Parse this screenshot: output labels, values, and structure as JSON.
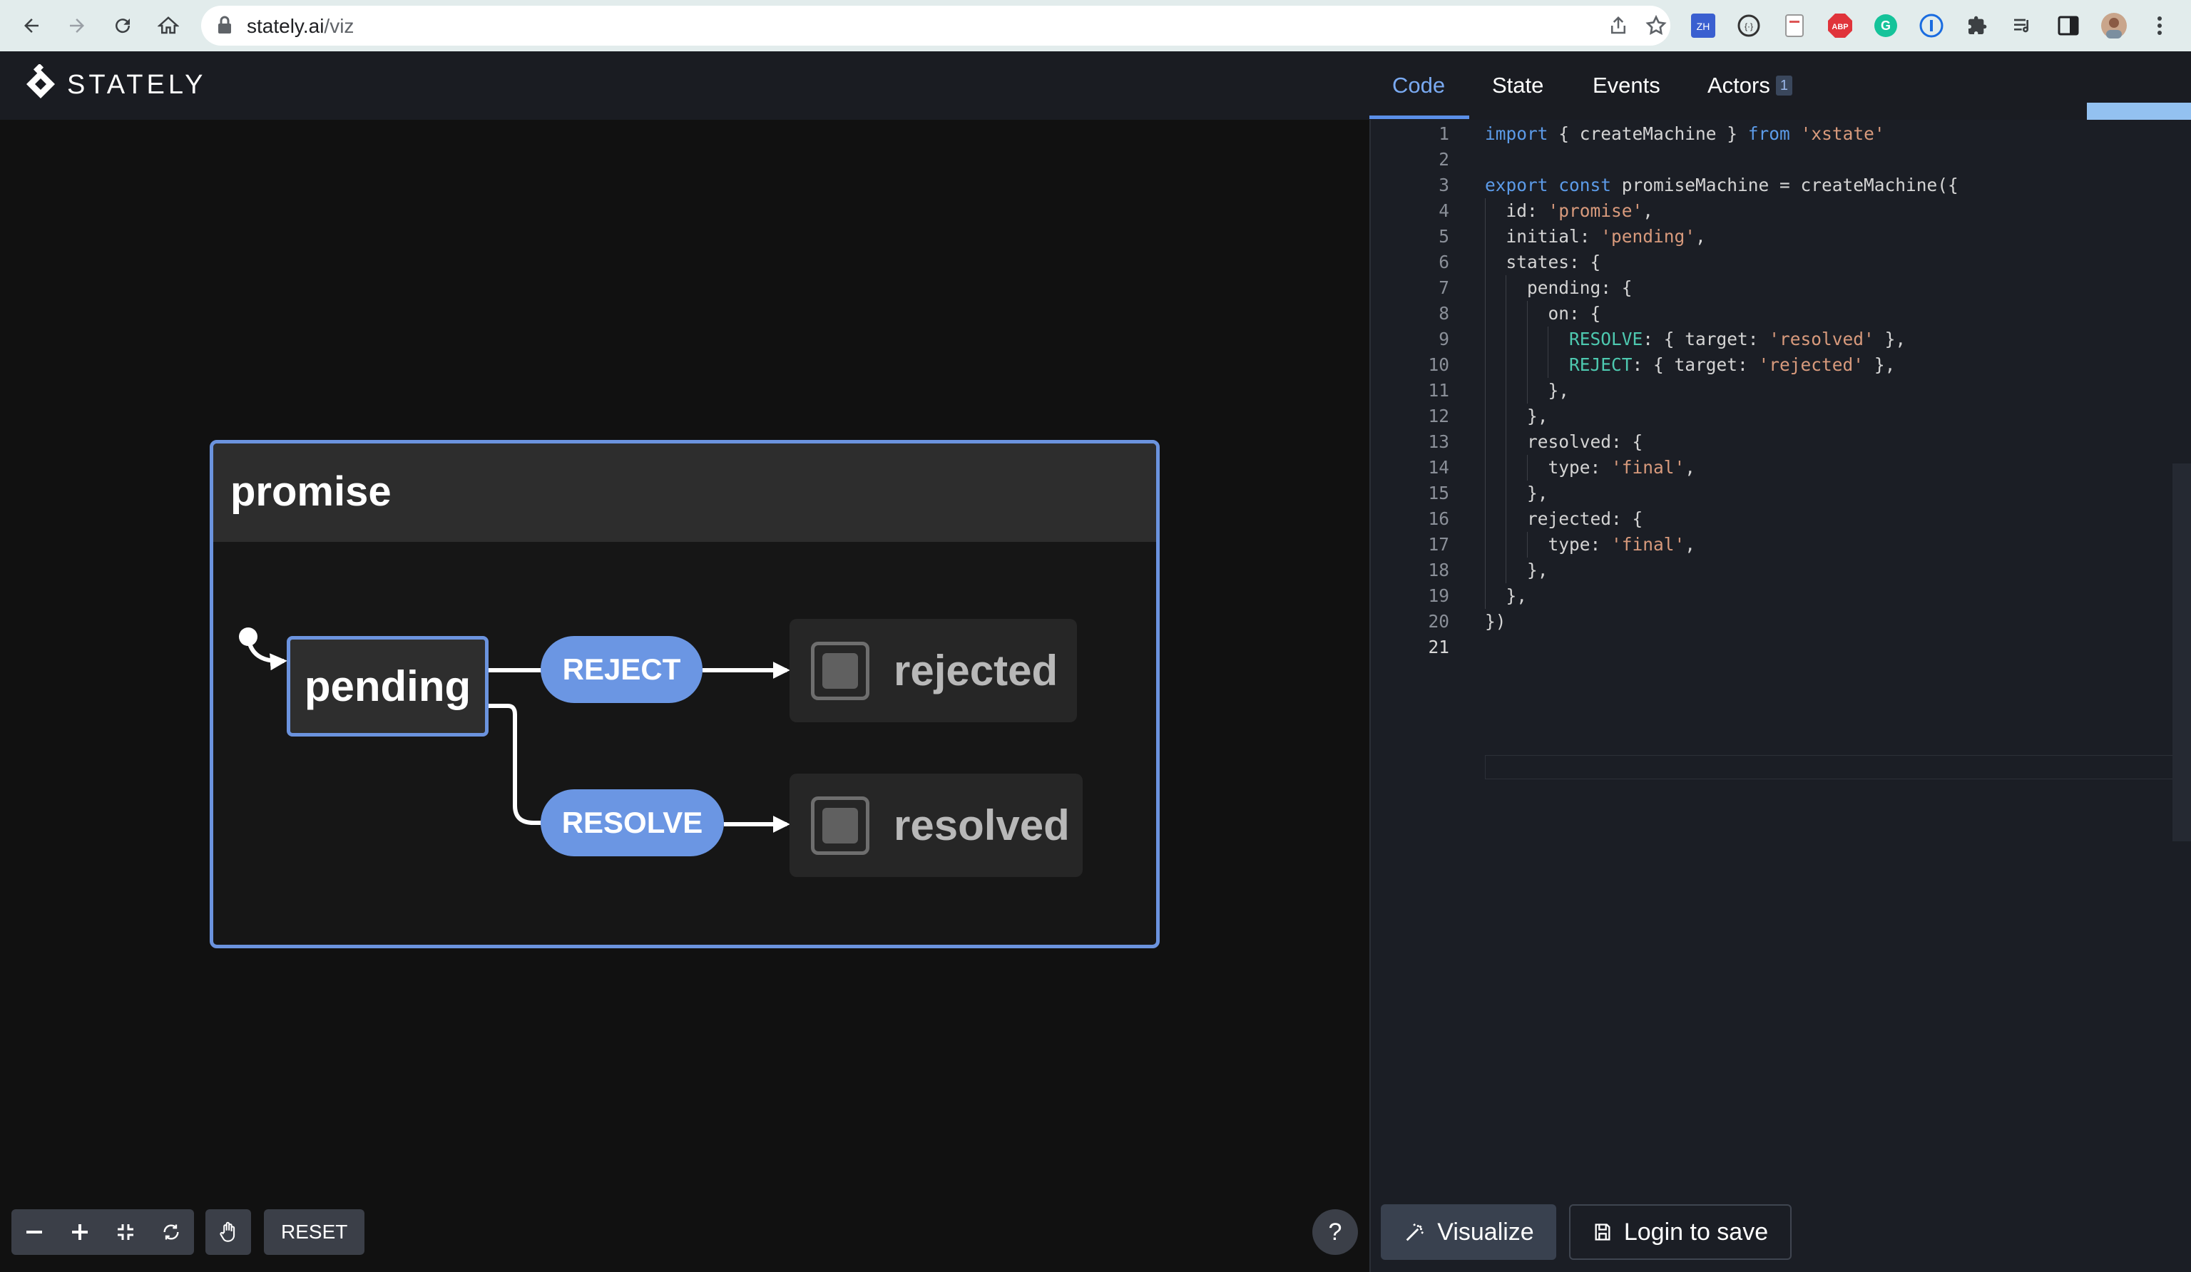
{
  "browser": {
    "url_host": "stately.ai",
    "url_path": "/viz"
  },
  "app": {
    "logo_text": "STATELY",
    "tabs": [
      {
        "label": "Code",
        "active": true
      },
      {
        "label": "State",
        "active": false
      },
      {
        "label": "Events",
        "active": false
      },
      {
        "label": "Actors",
        "active": false,
        "badge": "1"
      }
    ],
    "login_label": "Login"
  },
  "canvas": {
    "machine_title": "promise",
    "initial_state": "pending",
    "events": [
      {
        "label": "REJECT",
        "target": "rejected"
      },
      {
        "label": "RESOLVE",
        "target": "resolved"
      }
    ],
    "final_states": [
      "rejected",
      "resolved"
    ],
    "toolbar": {
      "reset_label": "RESET",
      "help_label": "?"
    }
  },
  "code": {
    "current_line": 21,
    "lines": [
      "import { createMachine } from 'xstate'",
      "",
      "export const promiseMachine = createMachine({",
      "  id: 'promise',",
      "  initial: 'pending',",
      "  states: {",
      "    pending: {",
      "      on: {",
      "        RESOLVE: { target: 'resolved' },",
      "        REJECT: { target: 'rejected' },",
      "      },",
      "    },",
      "    resolved: {",
      "      type: 'final',",
      "    },",
      "    rejected: {",
      "      type: 'final',",
      "    },",
      "  },",
      "})",
      ""
    ]
  },
  "actions": {
    "visualize_label": "Visualize",
    "login_to_save_label": "Login to save"
  },
  "colors": {
    "accent": "#6b96e3",
    "keyword": "#5c9be8",
    "string": "#d89a7c",
    "event_key": "#4ec9b0",
    "login_button": "#93c1f0"
  }
}
